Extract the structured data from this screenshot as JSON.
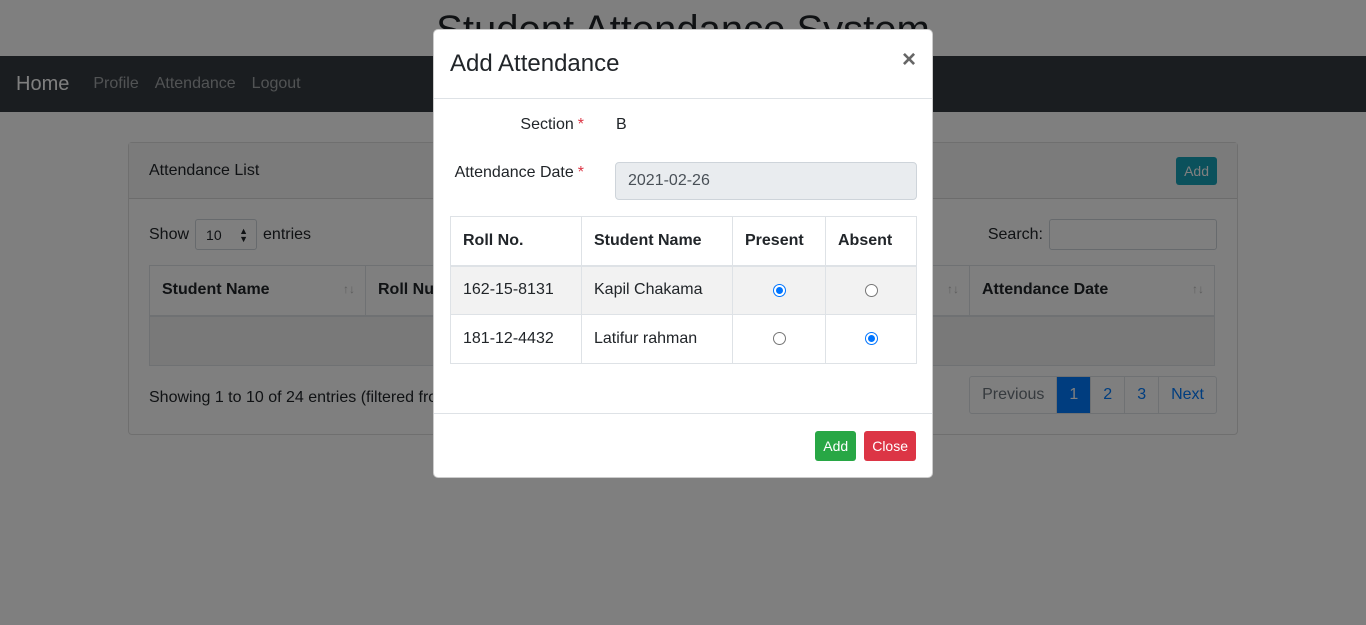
{
  "page": {
    "title": "Student Attendance System"
  },
  "navbar": {
    "brand": "Home",
    "links": [
      "Profile",
      "Attendance",
      "Logout"
    ]
  },
  "card": {
    "title": "Attendance List",
    "add_label": "Add",
    "show_label": "Show",
    "entries_value": "10",
    "entries_label": "entries",
    "search_label": "Search:",
    "columns": [
      "Student Name",
      "Roll Nu",
      "Attendance Date"
    ],
    "info": "Showing 1 to 10 of 24 entries (filtered fro",
    "pagination": [
      "Previous",
      "1",
      "2",
      "3",
      "Next"
    ],
    "active_page": "1"
  },
  "modal": {
    "title": "Add Attendance",
    "close_icon": "×",
    "section_label": "Section",
    "section_value": "B",
    "date_label": "Attendance Date",
    "date_value": "2021-02-26",
    "required_mark": "*",
    "table": {
      "headers": [
        "Roll No.",
        "Student Name",
        "Present",
        "Absent"
      ],
      "rows": [
        {
          "roll": "162-15-8131",
          "name": "Kapil Chakama",
          "status": "present"
        },
        {
          "roll": "181-12-4432",
          "name": "Latifur rahman",
          "status": "absent"
        }
      ]
    },
    "add_label": "Add",
    "close_label": "Close"
  }
}
